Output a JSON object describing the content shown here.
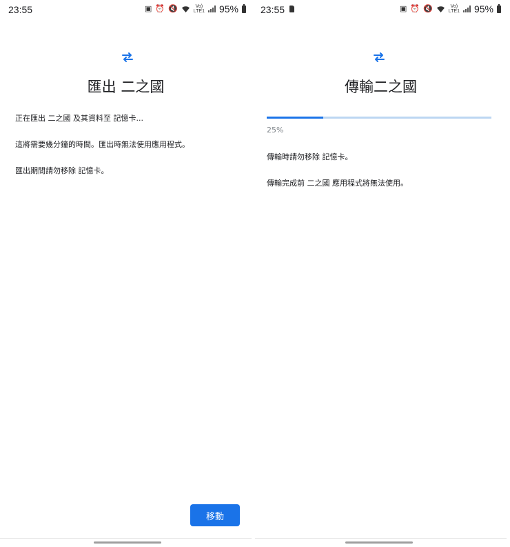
{
  "left": {
    "status": {
      "time": "23:55",
      "battery": "95%"
    },
    "title": "匯出 二之國",
    "lines": [
      "正在匯出 二之國 及其資料至 記憶卡...",
      "這將需要幾分鐘的時間。匯出時無法使用應用程式。",
      "匯出期間請勿移除 記憶卡。"
    ],
    "button_label": "移動"
  },
  "right": {
    "status": {
      "time": "23:55",
      "battery": "95%"
    },
    "title": "傳輸二之國",
    "progress": {
      "fraction": 0.25,
      "label": "25%"
    },
    "lines": [
      "傳輸時請勿移除 記憶卡。",
      "傳輸完成前 二之國 應用程式將無法使用。"
    ]
  },
  "colors": {
    "accent": "#1a73e8",
    "track": "#bcd6f2"
  },
  "icons": [
    "transfer-arrows-icon",
    "alarm-icon",
    "mute-icon",
    "wifi-icon",
    "signal-icon",
    "battery-icon",
    "sd-card-icon"
  ]
}
